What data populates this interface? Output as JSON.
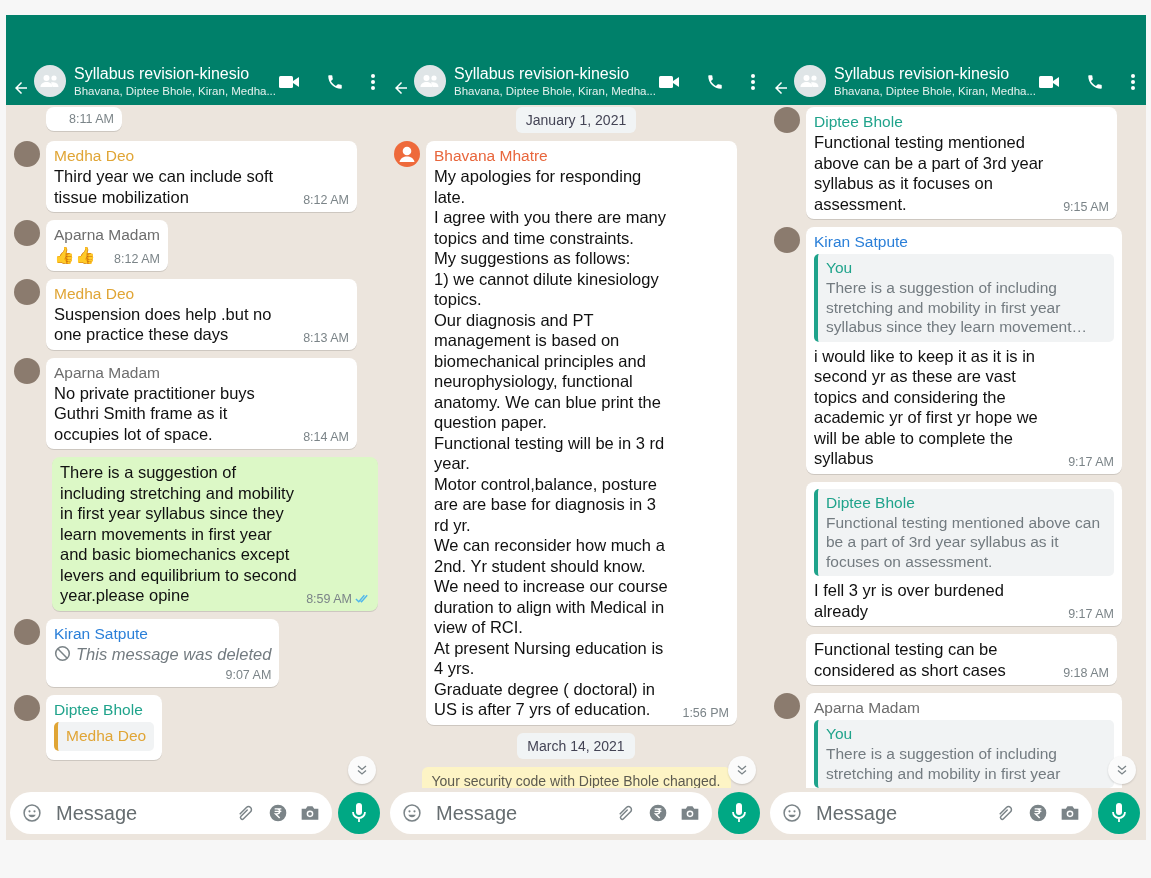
{
  "panels": [
    {
      "header": {
        "title": "Syllabus revision-kinesio",
        "subtitle": "Bhavana, Diptee Bhole, Kiran, Medha..."
      },
      "messages": [
        {
          "kind": "incoming",
          "time": "8:11 AM"
        },
        {
          "kind": "incoming",
          "avatar": {
            "kind": "photo"
          },
          "sender": "Medha Deo",
          "color": "#e0a535",
          "text": "Third year we can include soft tissue mobilization",
          "time": "8:12 AM"
        },
        {
          "kind": "incoming",
          "avatar": {
            "kind": "photo"
          },
          "sender": "Aparna Madam",
          "color": "#6d6d6d",
          "text": "👍👍",
          "time": "8:12 AM"
        },
        {
          "kind": "incoming",
          "avatar": {
            "kind": "photo"
          },
          "sender": "Medha Deo",
          "color": "#e0a535",
          "text": "Suspension does help .but no one practice these days",
          "time": "8:13 AM"
        },
        {
          "kind": "incoming",
          "avatar": {
            "kind": "photo"
          },
          "sender": "Aparna Madam",
          "color": "#6d6d6d",
          "text": "No private practitioner buys Guthri Smith frame as it occupies lot of space.",
          "time": "8:14 AM"
        },
        {
          "kind": "outgoing",
          "text": "There is a suggestion  of including stretching and  mobility in first year syllabus since they learn movements in first year and basic biomechanics except levers and equilibrium to second year.please opine",
          "time": "8:59 AM",
          "read": true
        },
        {
          "kind": "deleted",
          "avatar": {
            "kind": "photo"
          },
          "sender": "Kiran Satpute",
          "color": "#2a7fd8",
          "text": "This message was deleted",
          "time": "9:07 AM"
        },
        {
          "kind": "incoming",
          "avatar": {
            "kind": "photo"
          },
          "sender": "Diptee Bhole",
          "color": "#1fa38b",
          "quote": {
            "sender": "Medha Deo",
            "color": "#e0a535"
          }
        }
      ],
      "composer": {
        "placeholder": "Message"
      }
    },
    {
      "header": {
        "title": "Syllabus revision-kinesio",
        "subtitle": "Bhavana, Diptee Bhole, Kiran, Medha..."
      },
      "messages": [
        {
          "kind": "date",
          "text": "January 1, 2021"
        },
        {
          "kind": "incoming",
          "avatar": {
            "kind": "default"
          },
          "sender": "Bhavana Mhatre",
          "color": "#e8663c",
          "text": "My apologies for responding late.\nI agree with you there are many topics and time constraints.\nMy suggestions as follows:\n1) we cannot dilute kinesiology topics.\nOur diagnosis and PT management is based on biomechanical principles and neurophysiology, functional anatomy. We can blue print the question paper.\nFunctional testing will be in 3 rd year.\nMotor control,balance, posture are are base for diagnosis in 3 rd yr.\nWe can reconsider how much a 2nd. Yr student should know.\nWe need to increase our course duration to align with Medical in view of RCI.\nAt present Nursing education is 4 yrs.\nGraduate degree ( doctoral)  in US is after 7 yrs of education.",
          "time": "1:56 PM"
        },
        {
          "kind": "date",
          "text": "March 14, 2021"
        },
        {
          "kind": "system",
          "text": "Your security code with Diptee Bhole changed."
        }
      ],
      "composer": {
        "placeholder": "Message"
      }
    },
    {
      "header": {
        "title": "Syllabus revision-kinesio",
        "subtitle": "Bhavana, Diptee Bhole, Kiran, Medha..."
      },
      "messages": [
        {
          "kind": "incoming",
          "avatar": {
            "kind": "photo"
          },
          "sender": "Diptee Bhole",
          "color": "#1fa38b",
          "text": "Functional testing mentioned above can be a part of 3rd year syllabus as it focuses on assessment.",
          "time": "9:15 AM"
        },
        {
          "kind": "incoming",
          "avatar": {
            "kind": "photo"
          },
          "sender": "Kiran Satpute",
          "color": "#2a7fd8",
          "quote": {
            "sender": "You",
            "color": "#1fa38b",
            "text": "There is a suggestion  of including stretching and  mobility in first year syllabus since they learn movement…"
          },
          "text": "i would like to keep it as it is in second yr as these are vast topics and considering the academic yr of first yr hope we will be able to complete the syllabus",
          "time": "9:17 AM"
        },
        {
          "kind": "incoming",
          "quote": {
            "sender": "Diptee Bhole",
            "color": "#1fa38b",
            "text": "Functional testing mentioned above can be a part of 3rd year syllabus as it focuses on assessment."
          },
          "text": "I fell  3 yr is over burdened already",
          "time": "9:17 AM"
        },
        {
          "kind": "incoming",
          "text": "Functional testing can be considered as short cases",
          "time": "9:18 AM"
        },
        {
          "kind": "incoming",
          "avatar": {
            "kind": "photo"
          },
          "sender": "Aparna Madam",
          "color": "#6d6d6d",
          "quote": {
            "sender": "You",
            "color": "#1fa38b",
            "text": "There is a suggestion  of including stretching and  mobility in first year"
          }
        }
      ],
      "composer": {
        "placeholder": "Message"
      }
    }
  ]
}
